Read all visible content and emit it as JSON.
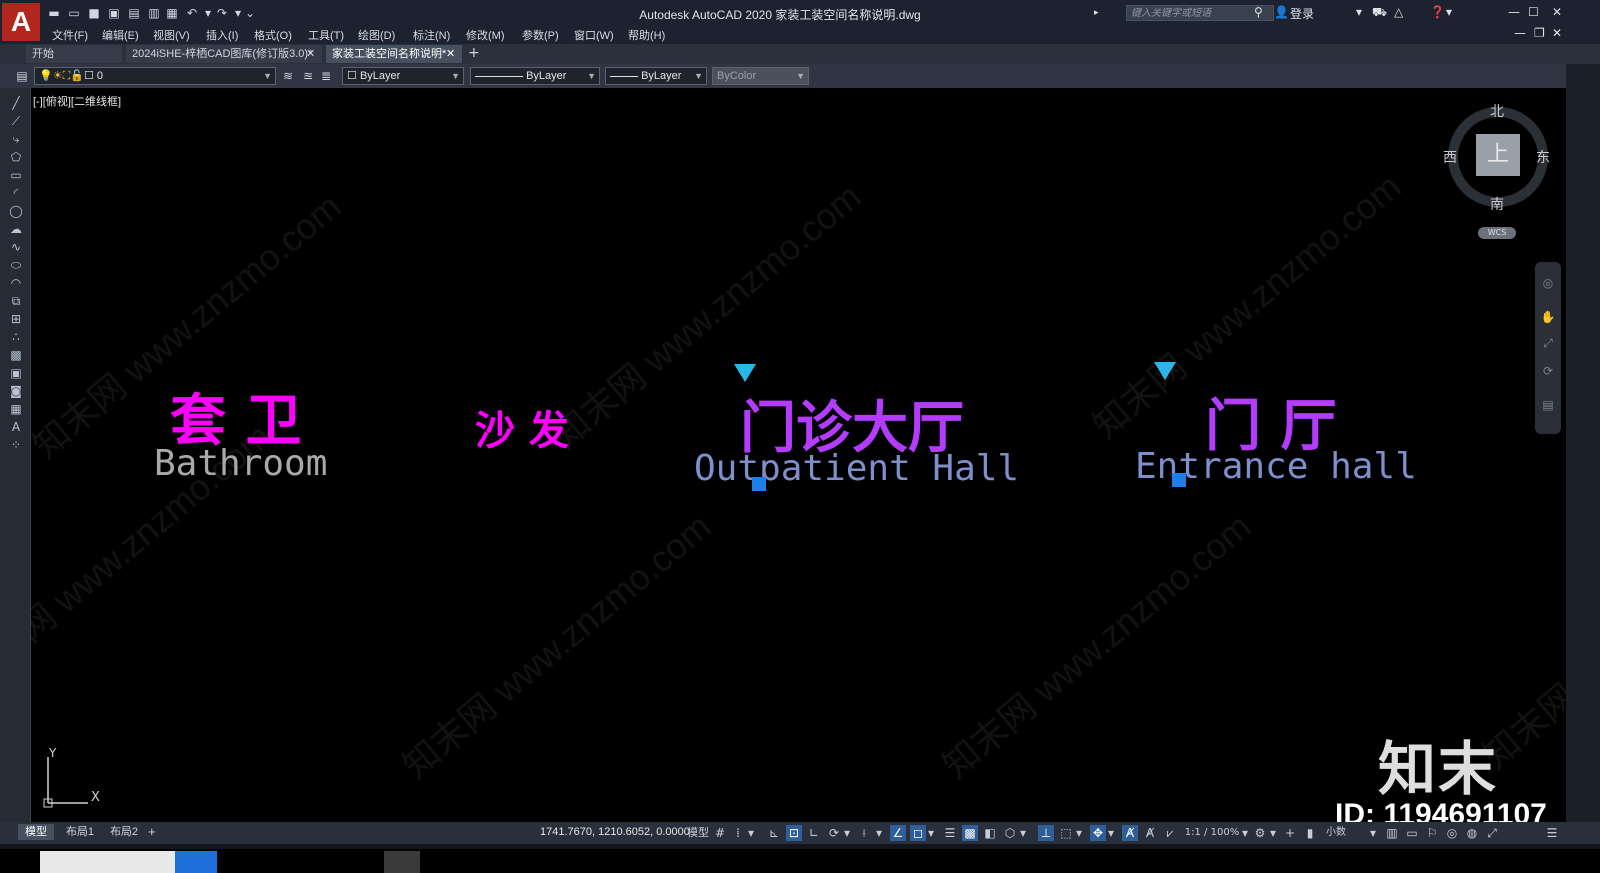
{
  "window": {
    "title": "Autodesk AutoCAD 2020    家装工装空间名称说明.dwg",
    "search_placeholder": "键入关键字或短语",
    "login_label": "登录",
    "app_logo": "A"
  },
  "menu": [
    "文件(F)",
    "编辑(E)",
    "视图(V)",
    "插入(I)",
    "格式(O)",
    "工具(T)",
    "绘图(D)",
    "标注(N)",
    "修改(M)",
    "参数(P)",
    "窗口(W)",
    "帮助(H)"
  ],
  "tabs": [
    {
      "label": "开始"
    },
    {
      "label": "2024iSHE-梓栖CAD图库(修订版3.0)*"
    },
    {
      "label": "家装工装空间名称说明*"
    }
  ],
  "layer_toolbar": {
    "layer_value": "0",
    "color_value": "ByLayer",
    "linetype_value": "ByLayer",
    "lineweight_value": "ByLayer",
    "plotstyle_value": "ByColor"
  },
  "viewport": {
    "label": "[-][俯视][二维线框]",
    "watermark": "知末网 www.znzmo.com"
  },
  "drawing_texts": [
    {
      "cn": "套 卫",
      "en": "Bathroom"
    },
    {
      "cn": "沙 发",
      "en": ""
    },
    {
      "cn": "门诊大厅",
      "en": "Outpatient Hall"
    },
    {
      "cn": "门 厅",
      "en": "Entrance hall"
    }
  ],
  "colors": {
    "magenta": "#ff00ff",
    "purple": "#b43cff",
    "gray_text": "#a9a9a9",
    "blue_text": "#7f8fcc",
    "grip_blue": "#1e7fe8",
    "marker_cyan": "#2ab6e8"
  },
  "viewcube": {
    "north": "北",
    "south": "南",
    "east": "东",
    "west": "西",
    "face": "上",
    "wcs": "WCS"
  },
  "ucs": {
    "y": "Y",
    "x": "X"
  },
  "layout_tabs": [
    "模型",
    "布局1",
    "布局2"
  ],
  "status": {
    "coords": "1741.7670, 1210.6052, 0.0000",
    "model_label": "模型",
    "scale_label": "1:1 / 100%",
    "units_label": "小数"
  },
  "brand": {
    "logo_text": "知末",
    "id_text": "ID: 1194691107"
  }
}
